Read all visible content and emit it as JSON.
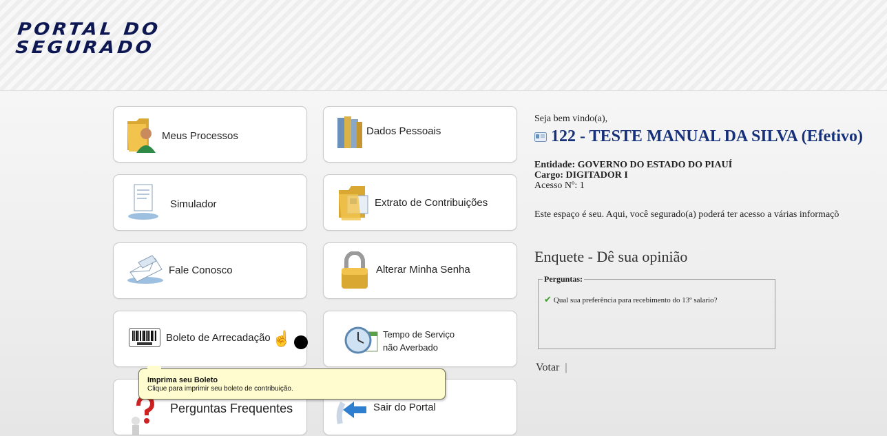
{
  "header": {
    "logo_line1": "PORTAL DO",
    "logo_line2": "SEGURADO"
  },
  "tiles": [
    {
      "label": "Meus Processos",
      "icon": "folder-user-icon"
    },
    {
      "label": "Dados Pessoais",
      "icon": "binders-icon"
    },
    {
      "label": "Simulador",
      "icon": "document-stand-icon"
    },
    {
      "label": "Extrato de Contribuições",
      "icon": "folder-document-icon"
    },
    {
      "label": "Fale Conosco",
      "icon": "envelope-icon"
    },
    {
      "label": "Alterar Minha Senha",
      "icon": "padlock-icon"
    },
    {
      "label": "Boleto de Arrecadação",
      "icon": "barcode-icon"
    },
    {
      "label_line1": "Tempo de Serviço",
      "label_line2": "não Averbado",
      "icon": "clock-calendar-icon"
    },
    {
      "label": "Perguntas Frequentes",
      "icon": "question-person-icon"
    },
    {
      "label": "Sair do Portal",
      "icon": "exit-arrow-icon"
    }
  ],
  "welcome": {
    "greeting": "Seja bem vindo(a),",
    "user": "122 - TESTE MANUAL DA SILVA (Efetivo)",
    "entidade": "Entidade: GOVERNO DO ESTADO DO PIAUÍ",
    "cargo": "Cargo: DIGITADOR I",
    "acesso": "Acesso Nº: 1",
    "description": "Este espaço é seu. Aqui, você segurado(a) poderá ter acesso a várias informaçõ"
  },
  "enquete": {
    "title": "Enquete - Dê sua opinião",
    "legend": "Perguntas:",
    "question": "Qual sua preferência para recebimento do 13º salario?",
    "vote_label": "Votar",
    "vote_sep": "|"
  },
  "tooltip": {
    "title": "Imprima seu Boleto",
    "text": "Clique para imprimir seu boleto de contribuição."
  },
  "colors": {
    "brand": "#0d1752",
    "user_name": "#16307a",
    "tooltip_bg": "#fffdd0"
  }
}
